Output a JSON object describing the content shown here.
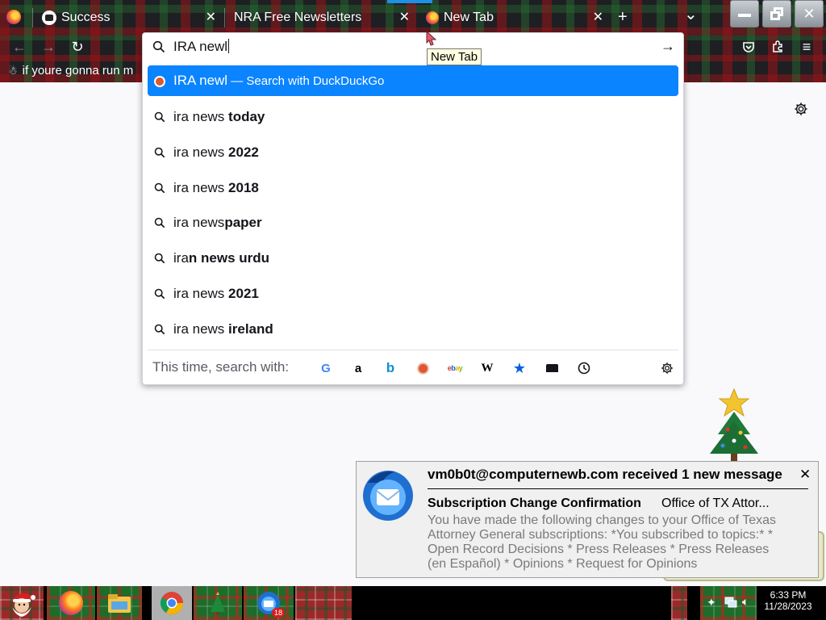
{
  "tabs": [
    {
      "label": "Success",
      "active": false
    },
    {
      "label": "NRA Free Newsletters",
      "active": false
    },
    {
      "label": "New Tab",
      "active": true
    }
  ],
  "new_tab_symbol": "+",
  "list_tabs_symbol": "⌄",
  "window_controls": {
    "minimize": "—",
    "restore": "❐",
    "close": "✕"
  },
  "bookmark": {
    "label": "if youre gonna run m"
  },
  "urlbar": {
    "typed": "IRA newl",
    "go_symbol": "→"
  },
  "tooltip": "New Tab",
  "suggestions": [
    {
      "pre": "IRA newl",
      "bold": "",
      "suffix": " — Search with DuckDuckGo",
      "type": "search-engine",
      "selected": true
    },
    {
      "pre": "ira news ",
      "bold": "today",
      "type": "search"
    },
    {
      "pre": "ira news ",
      "bold": "2022",
      "type": "search"
    },
    {
      "pre": "ira news ",
      "bold": "2018",
      "type": "search"
    },
    {
      "pre": "ira news",
      "bold": "paper",
      "type": "search"
    },
    {
      "pre": "ira",
      "bold": "n news urdu",
      "type": "search"
    },
    {
      "pre": "ira news ",
      "bold": "2021",
      "type": "search"
    },
    {
      "pre": "ira news ",
      "bold": "ireland",
      "type": "search"
    }
  ],
  "search_with_label": "This time, search with:",
  "engines": [
    {
      "name": "google-icon",
      "glyph": "G",
      "color": "#4285f4"
    },
    {
      "name": "amazon-icon",
      "glyph": "a",
      "color": "#000000"
    },
    {
      "name": "bing-icon",
      "glyph": "b",
      "color": "#0c8fd8"
    },
    {
      "name": "duckduckgo-icon",
      "glyph": "",
      "color": "#de5833"
    },
    {
      "name": "ebay-icon",
      "glyph": "ebay",
      "color": "#e53238"
    },
    {
      "name": "wikipedia-icon",
      "glyph": "W",
      "color": "#000000"
    },
    {
      "name": "bookmarks-icon",
      "glyph": "★",
      "color": "#0060df"
    },
    {
      "name": "tabs-icon",
      "glyph": "▬",
      "color": "#15141a"
    },
    {
      "name": "history-icon",
      "glyph": "◷",
      "color": "#15141a"
    }
  ],
  "notification": {
    "header": "vm0b0t@computernewb.com received 1 new message",
    "close": "✕",
    "subject": "Subscription Change Confirmation",
    "sender": "Office of TX Attor...",
    "body": "You have made the following changes to your Office of Texas Attorney General subscriptions: *You subscribed to topics:* * Open Record Decisions * Press Releases * Press Releases (en Español) * Opinions * Request for Opinions"
  },
  "taskbar": {
    "thunderbird_badge": "18",
    "time": "6:33 PM",
    "date": "11/28/2023"
  },
  "colors": {
    "selection": "#0a84ff",
    "tooltip_bg": "#ffffe1",
    "notification_bg": "#f0f0f0"
  }
}
